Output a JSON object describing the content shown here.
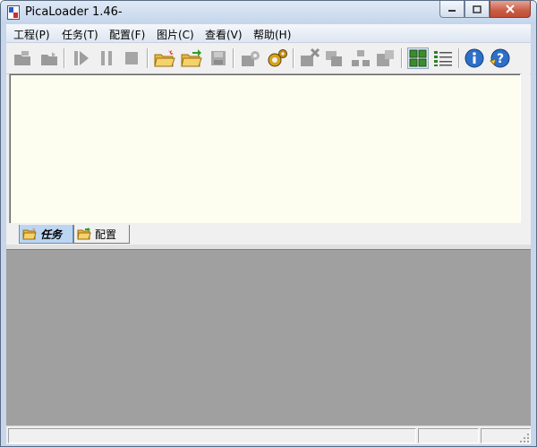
{
  "window": {
    "title": "PicaLoader 1.46-"
  },
  "menu": [
    {
      "label": "工程(P)"
    },
    {
      "label": "任务(T)"
    },
    {
      "label": "配置(F)"
    },
    {
      "label": "图片(C)"
    },
    {
      "label": "查看(V)"
    },
    {
      "label": "帮助(H)"
    }
  ],
  "toolbar": {
    "buttons": [
      {
        "icon": "new-project-icon",
        "enabled": false
      },
      {
        "icon": "open-project-icon",
        "enabled": false
      },
      {
        "icon": "start-icon",
        "enabled": false
      },
      {
        "icon": "pause-icon",
        "enabled": false
      },
      {
        "icon": "stop-icon",
        "enabled": false
      },
      {
        "icon": "new-task-folder-icon",
        "enabled": true
      },
      {
        "icon": "open-task-folder-icon",
        "enabled": true
      },
      {
        "icon": "save-icon",
        "enabled": false
      },
      {
        "icon": "task-settings-icon",
        "enabled": false
      },
      {
        "icon": "global-settings-icon",
        "enabled": true
      },
      {
        "icon": "delete-task-icon",
        "enabled": false
      },
      {
        "icon": "copy-task-icon",
        "enabled": false
      },
      {
        "icon": "move-task-icon",
        "enabled": false
      },
      {
        "icon": "export-task-icon",
        "enabled": false
      },
      {
        "icon": "thumbnail-view-icon",
        "enabled": true
      },
      {
        "icon": "detail-view-icon",
        "enabled": true
      },
      {
        "icon": "info-icon",
        "enabled": true
      },
      {
        "icon": "help-icon",
        "enabled": true
      }
    ]
  },
  "tabs": [
    {
      "label": "任务",
      "active": true
    },
    {
      "label": "配置",
      "active": false
    }
  ],
  "colors": {
    "task_panel_bg": "#fdfdf0",
    "preview_area_bg": "#a0a0a0",
    "active_tab_bg": "#bcd6f2"
  }
}
